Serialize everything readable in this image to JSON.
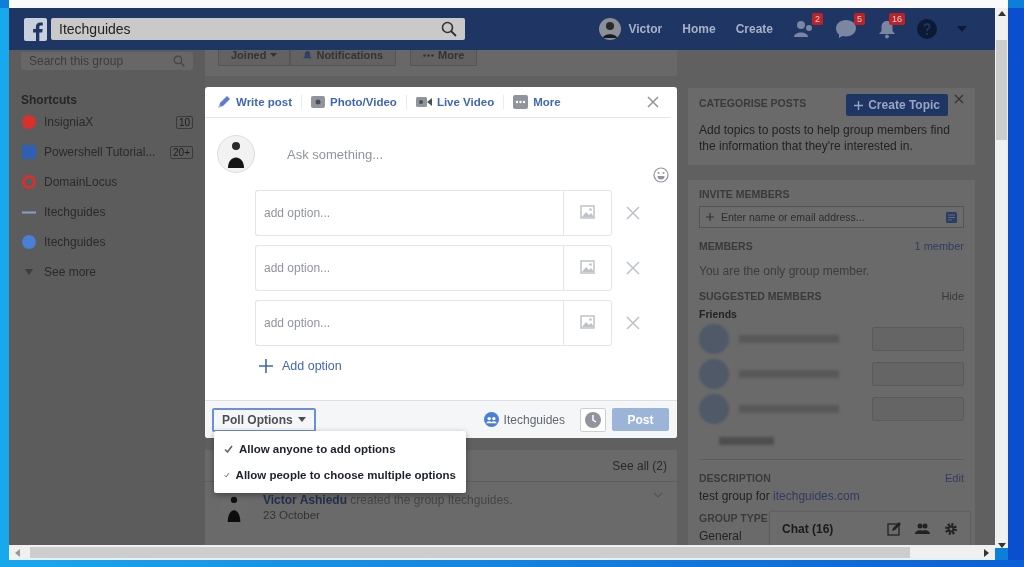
{
  "header": {
    "search_value": "Itechguides",
    "profile_name": "Victor",
    "nav": [
      "Home",
      "Create"
    ],
    "badges": [
      {
        "kind": "friends",
        "count": "2"
      },
      {
        "kind": "messages",
        "count": "5"
      },
      {
        "kind": "notifications",
        "count": "16"
      }
    ]
  },
  "sidebar": {
    "search_placeholder": "Search this group",
    "section_title": "Shortcuts",
    "items": [
      {
        "label": "InsigniaX",
        "count": "10",
        "kind": "circle",
        "color": "#d8302c"
      },
      {
        "label": "Powershell Tutorial...",
        "count": "20+",
        "kind": "square",
        "color": "#2f5fb5"
      },
      {
        "label": "DomainLocus",
        "kind": "ring",
        "color": "#d8302c"
      },
      {
        "label": "Itechguides",
        "kind": "line",
        "color": "#8a9fc8"
      },
      {
        "label": "Itechguides",
        "kind": "circle",
        "color": "#4a7fd6"
      }
    ],
    "see_more": "See more"
  },
  "group_actions": [
    {
      "label": "Joined",
      "kind": "caret"
    },
    {
      "label": "Notifications",
      "kind": "bell"
    },
    {
      "label": "More",
      "kind": "dots"
    }
  ],
  "composer": {
    "tabs": [
      {
        "label": "Write post",
        "kind": "pencil"
      },
      {
        "label": "Photo/Video",
        "kind": "camera"
      },
      {
        "label": "Live Video",
        "kind": "video"
      },
      {
        "label": "More",
        "kind": "dots"
      }
    ],
    "question_placeholder": "Ask something...",
    "options": [
      {
        "placeholder": "add option..."
      },
      {
        "placeholder": "add option..."
      },
      {
        "placeholder": "add option..."
      }
    ],
    "add_option": "Add option",
    "poll_options_button": "Poll Options",
    "poll_menu": [
      {
        "label": "Allow anyone to add options",
        "checked": true
      },
      {
        "label": "Allow people to choose multiple options",
        "checked": true
      }
    ],
    "audience": "Itechguides",
    "post_button": "Post",
    "post_disabled": true
  },
  "activity": {
    "see_all": "See all (2)",
    "author": "Victor Ashiedu",
    "action": "created the group Itechguides.",
    "date": "23 October"
  },
  "categorise": {
    "title": "CATEGORISE POSTS",
    "button": "Create Topic",
    "text": "Add topics to posts to help group members find the information that they're interested in."
  },
  "invite": {
    "title": "INVITE MEMBERS",
    "placeholder": "Enter name or email address...",
    "members_title": "MEMBERS",
    "members_count": "1 member",
    "members_text": "You are the only group member.",
    "suggested_title": "SUGGESTED MEMBERS",
    "hide": "Hide",
    "friends": "Friends",
    "description_title": "DESCRIPTION",
    "edit": "Edit",
    "description_text": "test group for",
    "description_link": "itechguides.com",
    "group_type_title": "GROUP TYPE",
    "group_type": "General"
  },
  "chat": {
    "label": "Chat (16)"
  }
}
